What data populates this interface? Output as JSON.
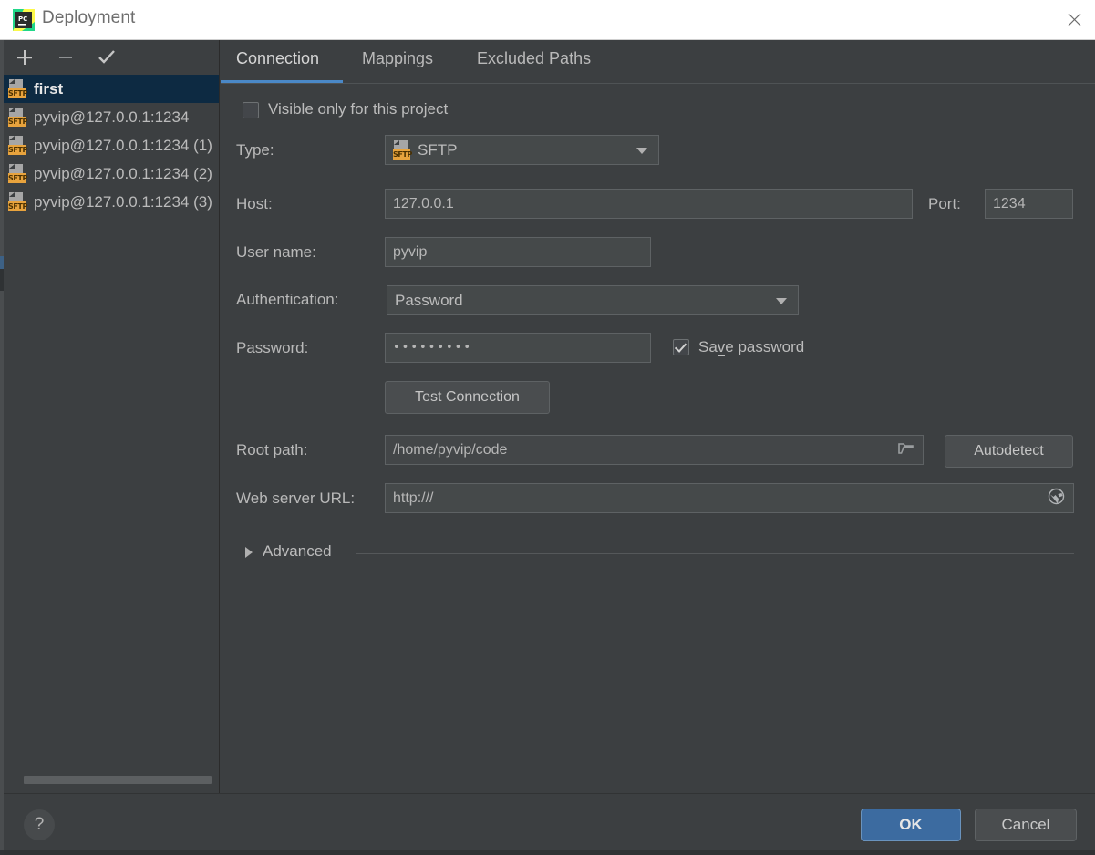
{
  "window": {
    "title": "Deployment",
    "app_icon": "pycharm-icon",
    "close_icon": "close-icon"
  },
  "sidebar": {
    "toolbar": [
      {
        "name": "add-server-button",
        "icon": "plus-icon"
      },
      {
        "name": "remove-server-button",
        "icon": "minus-icon"
      },
      {
        "name": "set-default-server-button",
        "icon": "check-icon"
      }
    ],
    "items": [
      {
        "label": "first",
        "icon": "sftp-icon",
        "selected": true
      },
      {
        "label": "pyvip@127.0.0.1:1234",
        "icon": "sftp-icon",
        "selected": false
      },
      {
        "label": "pyvip@127.0.0.1:1234 (1)",
        "icon": "sftp-icon",
        "selected": false
      },
      {
        "label": "pyvip@127.0.0.1:1234 (2)",
        "icon": "sftp-icon",
        "selected": false
      },
      {
        "label": "pyvip@127.0.0.1:1234 (3)",
        "icon": "sftp-icon",
        "selected": false
      }
    ],
    "scrollbar": "horizontal-scrollbar"
  },
  "tabs": [
    {
      "label": "Connection",
      "active": true
    },
    {
      "label": "Mappings",
      "active": false
    },
    {
      "label": "Excluded Paths",
      "active": false
    }
  ],
  "form": {
    "visible_only": {
      "label": "Visible only for this project",
      "checked": false
    },
    "type": {
      "label": "Type:",
      "value": "SFTP",
      "icon": "sftp-icon"
    },
    "host": {
      "label": "Host:",
      "value": "127.0.0.1"
    },
    "port": {
      "label": "Port:",
      "value": "1234"
    },
    "username": {
      "label": "User name:",
      "value": "pyvip"
    },
    "authentication": {
      "label": "Authentication:",
      "value": "Password"
    },
    "password": {
      "label": "Password:",
      "value": "•••••••••"
    },
    "save_password": {
      "label_a": "Sa",
      "label_mn": "v",
      "label_b": "e password",
      "checked": true
    },
    "test_connection": {
      "label": "Test Connection"
    },
    "root_path": {
      "label": "Root path:",
      "value": "/home/pyvip/code",
      "browse_icon": "folder-icon"
    },
    "autodetect": {
      "label": "Autodetect"
    },
    "web_server_url": {
      "label": "Web server URL:",
      "value": "http:///",
      "open_icon": "globe-icon"
    },
    "advanced": {
      "label": "Advanced",
      "expanded": false,
      "icon": "chevron-right-icon"
    }
  },
  "footer": {
    "help": {
      "label": "?",
      "icon": "help-icon"
    },
    "ok": {
      "label": "OK"
    },
    "cancel": {
      "label": "Cancel"
    }
  },
  "colors": {
    "dialog_bg": "#3c3f41",
    "titlebar_bg": "#ffffff",
    "selection_bg": "#0d2a42",
    "accent_blue": "#4a88c7",
    "ok_button": "#3c6ba0",
    "sftp_tag": "#e8a33d",
    "text": "#bcbcbc"
  }
}
